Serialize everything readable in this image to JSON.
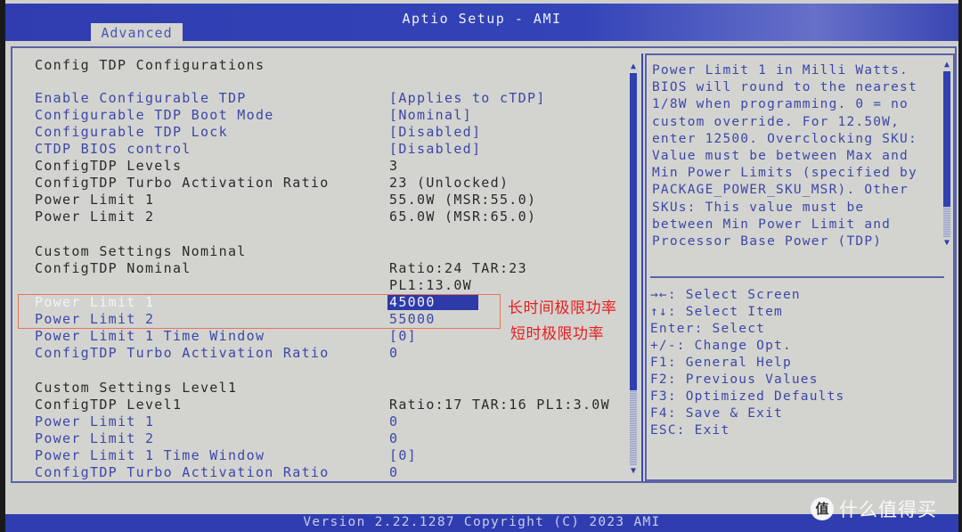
{
  "header": {
    "title": "Aptio Setup - AMI",
    "tabs": [
      {
        "label": "Advanced",
        "active": true
      }
    ]
  },
  "main": {
    "section_title": "Config TDP Configurations",
    "rows_top": [
      {
        "label": "Enable Configurable TDP",
        "value": "[Applies to cTDP]",
        "editable": true
      },
      {
        "label": "Configurable TDP Boot Mode",
        "value": "[Nominal]",
        "editable": true
      },
      {
        "label": "Configurable TDP Lock",
        "value": "[Disabled]",
        "editable": true
      },
      {
        "label": "CTDP BIOS control",
        "value": "[Disabled]",
        "editable": true
      },
      {
        "label": "ConfigTDP Levels",
        "value": "3",
        "editable": false
      },
      {
        "label": "ConfigTDP Turbo Activation Ratio",
        "value": "23 (Unlocked)",
        "editable": false
      },
      {
        "label": "Power Limit 1",
        "value": "55.0W (MSR:55.0)",
        "editable": false
      },
      {
        "label": "Power Limit 2",
        "value": "65.0W (MSR:65.0)",
        "editable": false
      }
    ],
    "nominal": {
      "heading": "Custom Settings Nominal",
      "info_label": "ConfigTDP Nominal",
      "info_value_line1": "Ratio:24 TAR:23",
      "info_value_line2": "PL1:13.0W",
      "rows": [
        {
          "label": "Power Limit 1",
          "value": "45000",
          "selected": true
        },
        {
          "label": "Power Limit 2",
          "value": "55000",
          "selected": false
        },
        {
          "label": "Power Limit 1 Time Window",
          "value": "[0]",
          "selected": false
        },
        {
          "label": "ConfigTDP Turbo Activation Ratio",
          "value": "0",
          "selected": false
        }
      ]
    },
    "level1": {
      "heading": "Custom Settings Level1",
      "info_label": "ConfigTDP Level1",
      "info_value": "Ratio:17 TAR:16 PL1:3.0W",
      "rows": [
        {
          "label": "Power Limit 1",
          "value": "0"
        },
        {
          "label": "Power Limit 2",
          "value": "0"
        },
        {
          "label": "Power Limit 1 Time Window",
          "value": "[0]"
        },
        {
          "label": "ConfigTDP Turbo Activation Ratio",
          "value": "0"
        }
      ]
    }
  },
  "help_panel": {
    "lines": [
      "Power Limit 1 in Milli Watts.",
      "BIOS will round to the nearest",
      "1/8W when programming. 0 = no",
      "custom override. For 12.50W,",
      "enter 12500. Overclocking SKU:",
      "Value must be between Max and",
      "Min Power Limits (specified by",
      "PACKAGE_POWER_SKU_MSR). Other",
      "SKUs: This value must be",
      "between Min Power Limit and",
      "Processor Base Power (TDP)"
    ],
    "keys": [
      "→←: Select Screen",
      "↑↓: Select Item",
      "Enter: Select",
      "+/-: Change Opt.",
      "F1: General Help",
      "F2: Previous Values",
      "F3: Optimized Defaults",
      "F4: Save & Exit",
      "ESC: Exit"
    ]
  },
  "footer": {
    "text": "Version 2.22.1287 Copyright (C) 2023 AMI"
  },
  "annotations": {
    "pl1_note": "长时间极限功率",
    "pl2_note": "短时极限功率",
    "color": "#e81e1e"
  },
  "watermark": {
    "logo": "值",
    "text": "什么值得买"
  },
  "colors": {
    "accent_blue": "#2f3db0",
    "panel_bg": "#d3d4d0",
    "item_blue": "#3d47a8"
  }
}
